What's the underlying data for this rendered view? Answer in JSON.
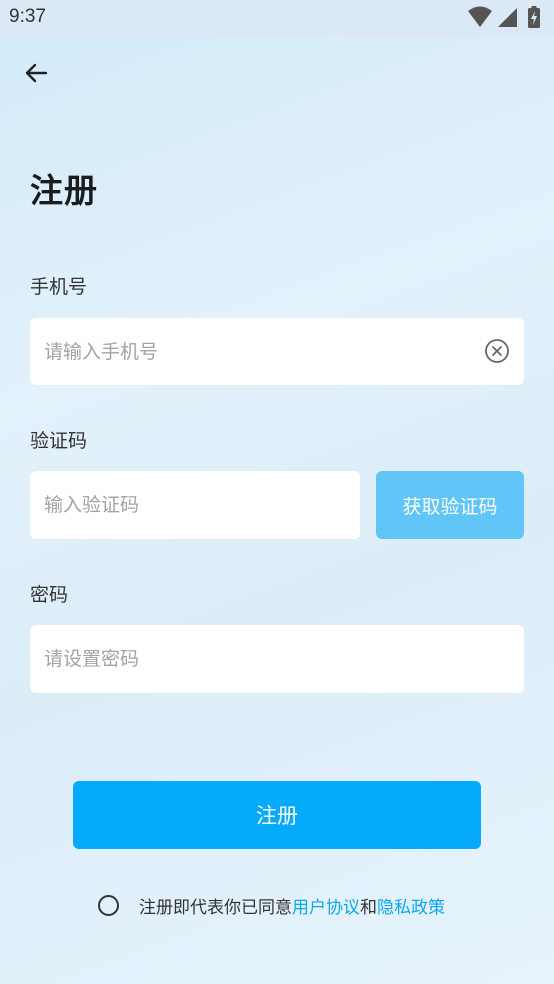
{
  "status_bar": {
    "time": "9:37",
    "icons": [
      "wifi-icon",
      "signal-icon",
      "battery-charging-icon"
    ]
  },
  "header": {
    "back_icon": "arrow-left-icon",
    "title": "注册"
  },
  "form": {
    "phone": {
      "label": "手机号",
      "placeholder": "请输入手机号",
      "value": "",
      "clear_icon": "clear-circle-icon"
    },
    "code": {
      "label": "验证码",
      "placeholder": "输入验证码",
      "value": "",
      "button_label": "获取验证码"
    },
    "password": {
      "label": "密码",
      "placeholder": "请设置密码",
      "value": ""
    }
  },
  "register_button": {
    "label": "注册"
  },
  "agreement": {
    "checked": false,
    "prefix": "注册即代表你已同意",
    "user_agreement": "用户协议",
    "and": "和",
    "privacy_policy": "隐私政策"
  },
  "colors": {
    "primary": "#05abfa",
    "code_button": "#61c5f7",
    "link": "#0aa8f0",
    "background": "#dcedf8"
  }
}
